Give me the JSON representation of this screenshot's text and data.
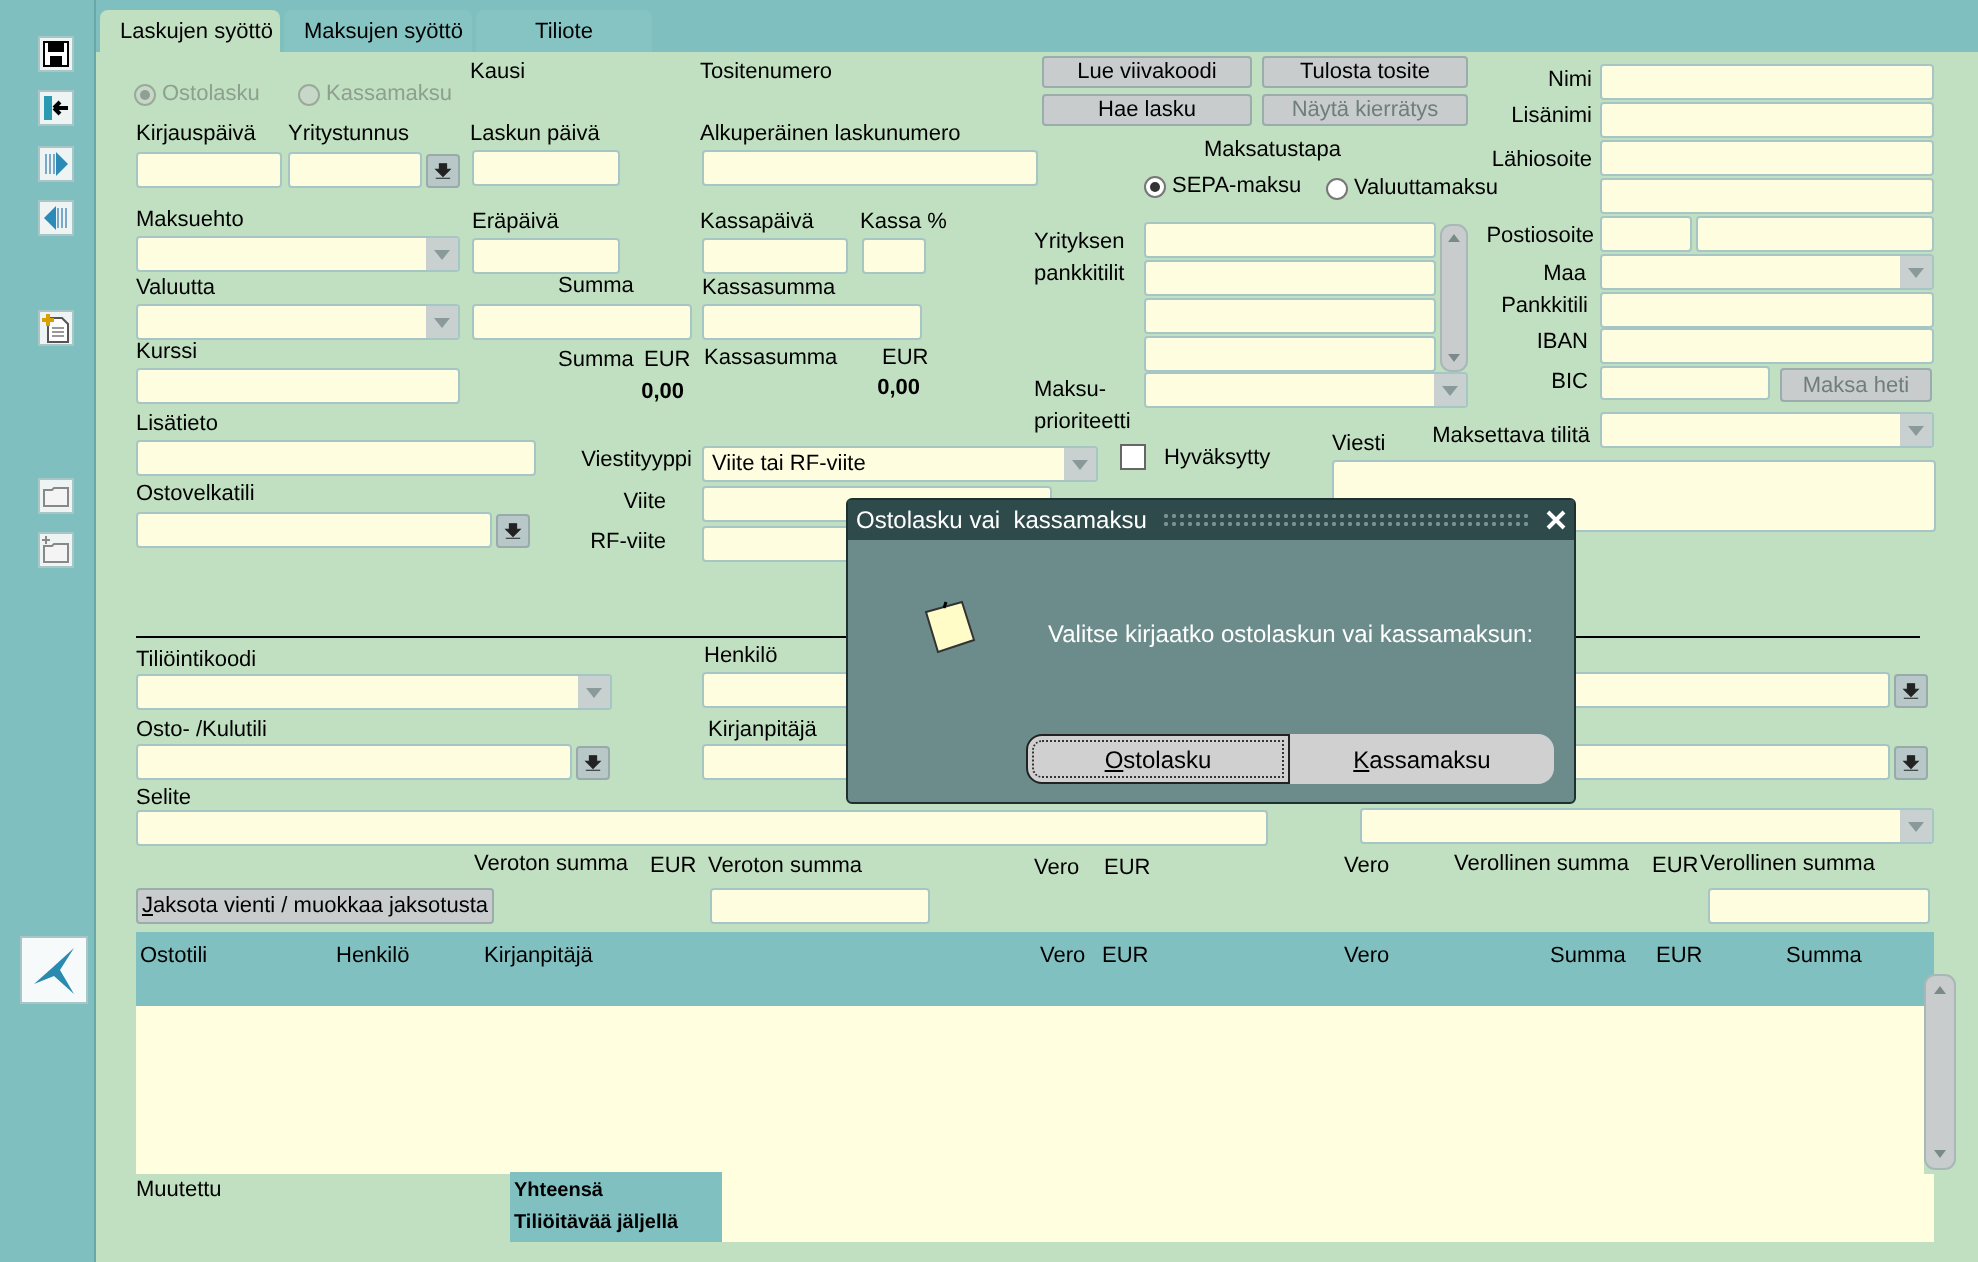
{
  "tabs": [
    {
      "label": "Laskujen syöttö",
      "selected": true
    },
    {
      "label": "Maksujen syöttö",
      "selected": false
    },
    {
      "label": "Tiliote",
      "selected": false
    }
  ],
  "form": {
    "items": [
      {
        "kind": "radio",
        "text": "Ostolasku",
        "selected": true,
        "disabled": true
      },
      {
        "kind": "radio",
        "text": "Kassamaksu",
        "selected": false,
        "disabled": true
      },
      {
        "kind": "label",
        "text": "Kausi"
      },
      {
        "kind": "label",
        "text": "Tositenumero"
      },
      {
        "kind": "label",
        "text": "Kirjauspäivä"
      },
      {
        "kind": "label",
        "text": "Yritystunnus"
      },
      {
        "kind": "label",
        "text": "Laskun päivä"
      },
      {
        "kind": "label",
        "text": "Alkuperäinen laskunumero"
      },
      {
        "kind": "field"
      },
      {
        "kind": "lov"
      },
      {
        "kind": "field"
      },
      {
        "kind": "field"
      },
      {
        "kind": "label",
        "text": "Maksuehto"
      },
      {
        "kind": "label",
        "text": "Eräpäivä"
      },
      {
        "kind": "label",
        "text": "Kassapäivä"
      },
      {
        "kind": "label",
        "text": "Kassa %"
      },
      {
        "kind": "combo"
      },
      {
        "kind": "field"
      },
      {
        "kind": "field"
      },
      {
        "kind": "field"
      },
      {
        "kind": "label",
        "text": "Valuutta"
      },
      {
        "kind": "label",
        "text": "Summa"
      },
      {
        "kind": "label",
        "text": "Kassasumma"
      },
      {
        "kind": "combo"
      },
      {
        "kind": "field"
      },
      {
        "kind": "field"
      },
      {
        "kind": "label",
        "text": "Kurssi"
      },
      {
        "kind": "label",
        "text": "Summa"
      },
      {
        "kind": "label",
        "text": "EUR"
      },
      {
        "kind": "label",
        "text": "Kassasumma"
      },
      {
        "kind": "label",
        "text": "EUR"
      },
      {
        "kind": "field"
      },
      {
        "kind": "value",
        "text": "0,00"
      },
      {
        "kind": "value",
        "text": "0,00"
      },
      {
        "kind": "label",
        "text": "Lisätieto"
      },
      {
        "kind": "field"
      },
      {
        "kind": "label",
        "text": "Ostovelkatili"
      },
      {
        "kind": "lov"
      },
      {
        "kind": "label",
        "text": "Viestityyppi"
      },
      {
        "kind": "combo",
        "value": "Viite tai RF-viite"
      },
      {
        "kind": "label",
        "text": "Viite"
      },
      {
        "kind": "field"
      },
      {
        "kind": "label",
        "text": "RF-viite"
      },
      {
        "kind": "field"
      },
      {
        "kind": "checkbox",
        "text": "Hyväksytty",
        "checked": false
      },
      {
        "kind": "button",
        "text": "Lue viivakoodi",
        "disabled": false
      },
      {
        "kind": "button",
        "text": "Tulosta tosite",
        "disabled": false
      },
      {
        "kind": "button",
        "text": "Hae lasku",
        "disabled": false
      },
      {
        "kind": "button",
        "text": "Näytä kierrätys",
        "disabled": true
      },
      {
        "kind": "label",
        "text": "Maksatustapa"
      },
      {
        "kind": "radio",
        "text": "SEPA-maksu",
        "selected": true,
        "disabled": false
      },
      {
        "kind": "radio",
        "text": "Valuuttamaksu",
        "selected": false,
        "disabled": false
      },
      {
        "kind": "label",
        "text": "Yrityksen pankkitilit"
      },
      {
        "kind": "list"
      },
      {
        "kind": "label",
        "text": "Maksu-prioriteetti"
      },
      {
        "kind": "combo"
      },
      {
        "kind": "label",
        "text": "Nimi"
      },
      {
        "kind": "field"
      },
      {
        "kind": "label",
        "text": "Lisänimi"
      },
      {
        "kind": "field"
      },
      {
        "kind": "label",
        "text": "Lähiosoite"
      },
      {
        "kind": "field"
      },
      {
        "kind": "field"
      },
      {
        "kind": "label",
        "text": "Postiosoite"
      },
      {
        "kind": "field"
      },
      {
        "kind": "field"
      },
      {
        "kind": "label",
        "text": "Maa"
      },
      {
        "kind": "combo"
      },
      {
        "kind": "label",
        "text": "Pankkitili"
      },
      {
        "kind": "field"
      },
      {
        "kind": "label",
        "text": "IBAN"
      },
      {
        "kind": "field"
      },
      {
        "kind": "label",
        "text": "BIC"
      },
      {
        "kind": "field"
      },
      {
        "kind": "button",
        "text": "Maksa heti",
        "disabled": true
      },
      {
        "kind": "label",
        "text": "Maksettava tilitä"
      },
      {
        "kind": "combo"
      },
      {
        "kind": "label",
        "text": "Viesti"
      },
      {
        "kind": "textarea"
      },
      {
        "kind": "label",
        "text": "Tiliöintikoodi"
      },
      {
        "kind": "combo"
      },
      {
        "kind": "label",
        "text": "Henkilö"
      },
      {
        "kind": "lov"
      },
      {
        "kind": "label",
        "text": "Osto- /Kulutili"
      },
      {
        "kind": "lov"
      },
      {
        "kind": "label",
        "text": "Kirjanpitäjä"
      },
      {
        "kind": "lov"
      },
      {
        "kind": "label",
        "text": "Selite"
      },
      {
        "kind": "field"
      },
      {
        "kind": "combo"
      },
      {
        "kind": "label",
        "text": "Veroton summa"
      },
      {
        "kind": "label",
        "text": "EUR"
      },
      {
        "kind": "label",
        "text": "Veroton summa"
      },
      {
        "kind": "label",
        "text": "Vero"
      },
      {
        "kind": "label",
        "text": "EUR"
      },
      {
        "kind": "label",
        "text": "Vero"
      },
      {
        "kind": "label",
        "text": "Verollinen summa"
      },
      {
        "kind": "label",
        "text": "EUR"
      },
      {
        "kind": "label",
        "text": "Verollinen summa"
      },
      {
        "kind": "button",
        "text": "Jaksota vienti / muokkaa jaksotusta",
        "disabled": false
      },
      {
        "kind": "field"
      },
      {
        "kind": "field"
      }
    ]
  },
  "table": {
    "columns": [
      "Ostotili",
      "Henkilö",
      "Kirjanpitäjä",
      "Vero",
      "EUR",
      "Vero",
      "Summa",
      "EUR",
      "Summa"
    ],
    "footer_label": "Muutettu",
    "totals": [
      "Yhteensä",
      "Tiliöitävää jäljellä"
    ]
  },
  "dialog": {
    "title": "Ostolasku vai  kassamaksu",
    "message": "Valitse kirjaatko ostolaskun vai kassamaksun:",
    "buttons": [
      {
        "label": "Ostolasku",
        "selected": true
      },
      {
        "label": "Kassamaksu",
        "selected": false
      }
    ]
  }
}
